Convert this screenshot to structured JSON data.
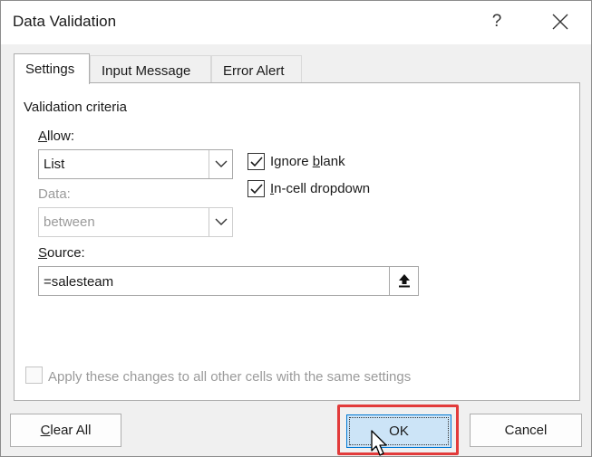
{
  "window": {
    "title": "Data Validation",
    "help_label": "?"
  },
  "tabs": [
    {
      "label": "Settings",
      "active": true
    },
    {
      "label": "Input Message",
      "active": false
    },
    {
      "label": "Error Alert",
      "active": false
    }
  ],
  "settings": {
    "section_title": "Validation criteria",
    "allow": {
      "label_underlined": "A",
      "label_rest": "llow:",
      "value": "List"
    },
    "data": {
      "label": "Data:",
      "value": "between"
    },
    "ignore_blank": {
      "label_pre": "Ignore ",
      "label_underlined": "b",
      "label_post": "lank",
      "checked": true
    },
    "in_cell_dropdown": {
      "label_underlined": "I",
      "label_rest": "n-cell dropdown",
      "checked": true
    },
    "source": {
      "label_underlined": "S",
      "label_rest": "ource:",
      "value": "=salesteam"
    },
    "apply_all": {
      "label": "Apply these changes to all other cells with the same settings",
      "checked": false
    }
  },
  "buttons": {
    "clear_all_underlined": "C",
    "clear_all_rest": "lear All",
    "ok": "OK",
    "cancel": "Cancel"
  },
  "colors": {
    "highlight": "#e23b3b",
    "ok_fill": "#cce4f7",
    "ok_border": "#0078d4"
  }
}
